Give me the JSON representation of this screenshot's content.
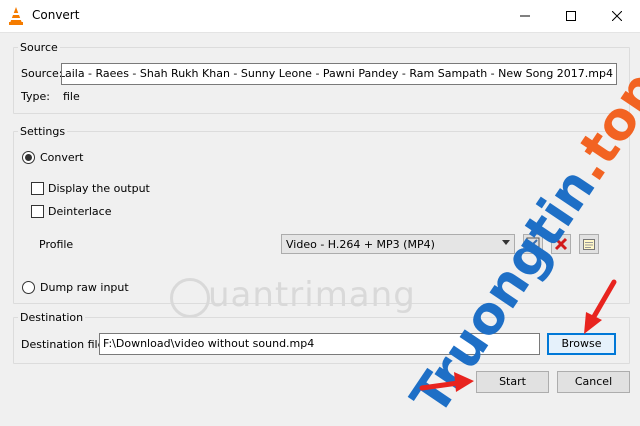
{
  "window": {
    "title": "Convert",
    "controls": {
      "minimize": "—",
      "maximize": "☐",
      "close": "✕"
    }
  },
  "source": {
    "group_label": "Source",
    "source_label": "Source:",
    "source_value": "D:\\Music\\Songs/Laila Main Laila - Raees - Shah Rukh Khan - Sunny Leone - Pawni Pandey - Ram Sampath - New Song 2017.mp4",
    "type_label": "Type:",
    "type_value": "file"
  },
  "settings": {
    "group_label": "Settings",
    "convert_label": "Convert",
    "display_output_label": "Display the output",
    "deinterlace_label": "Deinterlace",
    "profile_label": "Profile",
    "profile_value": "Video - H.264 + MP3 (MP4)",
    "dump_raw_label": "Dump raw input"
  },
  "destination": {
    "group_label": "Destination",
    "file_label": "Destination file:",
    "file_value": "F:\\Download\\video without sound.mp4",
    "browse_label": "Browse"
  },
  "buttons": {
    "start_label": "Start",
    "cancel_label": "Cancel"
  },
  "watermarks": {
    "quantrimang": "uantrimang",
    "truongtin_main": "Truongtin",
    "truongtin_suffix": ".top"
  },
  "colors": {
    "accent": "#0078d7",
    "arrow_red": "#e8241f",
    "logo_blue": "#1e6fc6",
    "logo_orange": "#f26322"
  }
}
